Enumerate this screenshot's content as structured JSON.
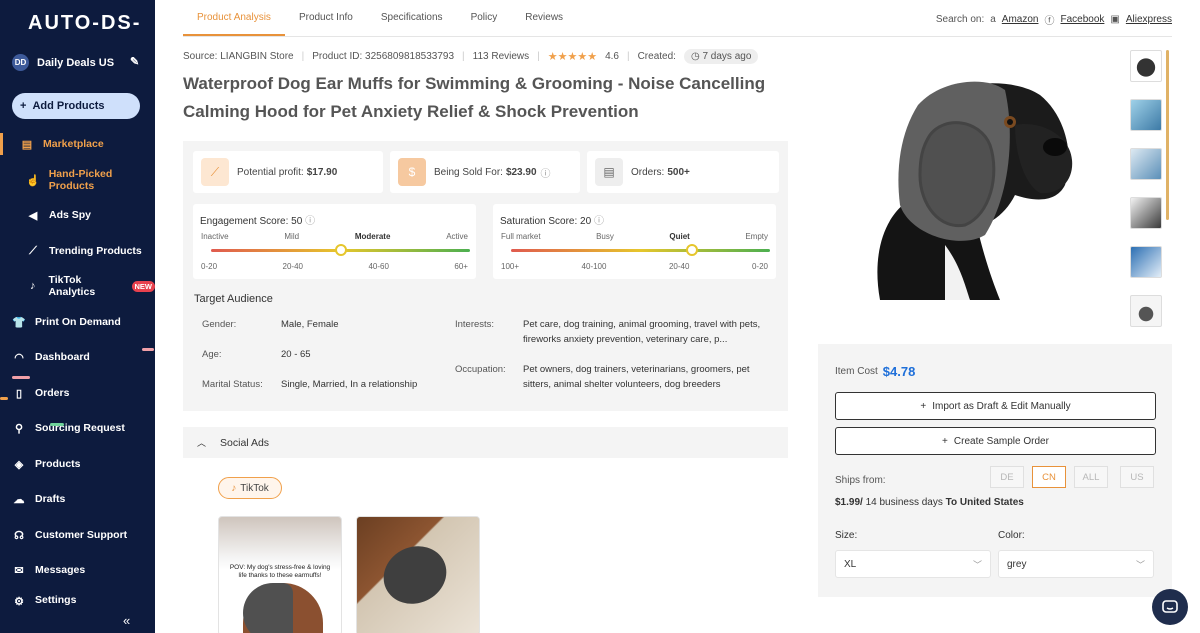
{
  "sidebar": {
    "logo": "AUTO-DS-",
    "store": {
      "initials": "DD",
      "name": "Daily Deals US"
    },
    "add_products": "Add Products",
    "items": [
      {
        "label": "Marketplace",
        "icon": "store-icon"
      },
      {
        "label": "Hand-Picked Products",
        "icon": "hand-icon"
      },
      {
        "label": "Ads Spy",
        "icon": "megaphone-icon"
      },
      {
        "label": "Trending Products",
        "icon": "trending-icon"
      },
      {
        "label": "TikTok Analytics",
        "icon": "tiktok-icon",
        "badge": "NEW"
      },
      {
        "label": "Print On Demand",
        "icon": "shirt-icon"
      },
      {
        "label": "Dashboard",
        "icon": "gauge-icon"
      },
      {
        "label": "Orders",
        "icon": "clipboard-icon"
      },
      {
        "label": "Sourcing Request",
        "icon": "sourcing-icon"
      },
      {
        "label": "Products",
        "icon": "box-icon"
      },
      {
        "label": "Drafts",
        "icon": "cloud-upload-icon"
      },
      {
        "label": "Customer Support",
        "icon": "headset-icon"
      },
      {
        "label": "Messages",
        "icon": "mail-icon"
      },
      {
        "label": "Settings",
        "icon": "gear-icon"
      }
    ],
    "collapse": "«"
  },
  "tabs": [
    "Product Analysis",
    "Product Info",
    "Specifications",
    "Policy",
    "Reviews"
  ],
  "search_on": {
    "label": "Search on:",
    "links": [
      "Amazon",
      "Facebook",
      "Aliexpress"
    ]
  },
  "meta": {
    "source": "Source: LIANGBIN Store",
    "product_id": "Product ID: 3256809818533793",
    "reviews": "113 Reviews",
    "stars": "★★★★★",
    "rating": "4.6",
    "created_label": "Created:",
    "created": "7 days ago"
  },
  "title": "Waterproof Dog Ear Muffs for Swimming & Grooming - Noise Cancelling Calming Hood for Pet Anxiety Relief & Shock Prevention",
  "stats": {
    "profit": {
      "label": "Potential profit:",
      "value": "$17.90"
    },
    "sold_for": {
      "label": "Being Sold For:",
      "value": "$23.90"
    },
    "orders": {
      "label": "Orders:",
      "value": "500+"
    }
  },
  "engagement": {
    "title": "Engagement Score: 50",
    "score": 50,
    "labels": [
      "Inactive",
      "Mild",
      "Moderate",
      "Active"
    ],
    "ranges": [
      "0-20",
      "20-40",
      "40-60",
      "60+"
    ],
    "active_label": "Moderate"
  },
  "saturation": {
    "title": "Saturation Score: 20",
    "score": 20,
    "labels": [
      "Full market",
      "Busy",
      "Quiet",
      "Empty"
    ],
    "ranges": [
      "100+",
      "40-100",
      "20-40",
      "0-20"
    ],
    "active_label": "Quiet"
  },
  "audience": {
    "title": "Target Audience",
    "gender_label": "Gender:",
    "gender": "Male, Female",
    "age_label": "Age:",
    "age": "20 - 65",
    "marital_label": "Marital Status:",
    "marital": "Single, Married, In a relationship",
    "interests_label": "Interests:",
    "interests": "Pet care, dog training, animal grooming, travel with pets, fireworks anxiety prevention, veterinary care, p...",
    "occupation_label": "Occupation:",
    "occupation": "Pet owners, dog trainers, veterinarians, groomers, pet sitters, animal shelter volunteers, dog breeders"
  },
  "social": {
    "title": "Social Ads",
    "platform": "TikTok",
    "ad1_caption": "POV: My dog's stress-free & loving life thanks to these earmuffs!"
  },
  "purchase": {
    "item_cost_label": "Item Cost",
    "item_cost": "$4.78",
    "import_btn": "Import as Draft & Edit Manually",
    "sample_btn": "Create Sample Order",
    "ships_label": "Ships from:",
    "ship_options": [
      "DE",
      "CN",
      "ALL",
      "US"
    ],
    "ship_selected": "CN",
    "ship_price": "$1.99/",
    "ship_days": "14 business days",
    "ship_dest": "To United States",
    "size_label": "Size:",
    "size_value": "XL",
    "color_label": "Color:",
    "color_value": "grey"
  },
  "colors": {
    "accent": "#e8923a",
    "sidebar": "#0d1b3e",
    "cost": "#1e6fd9"
  }
}
